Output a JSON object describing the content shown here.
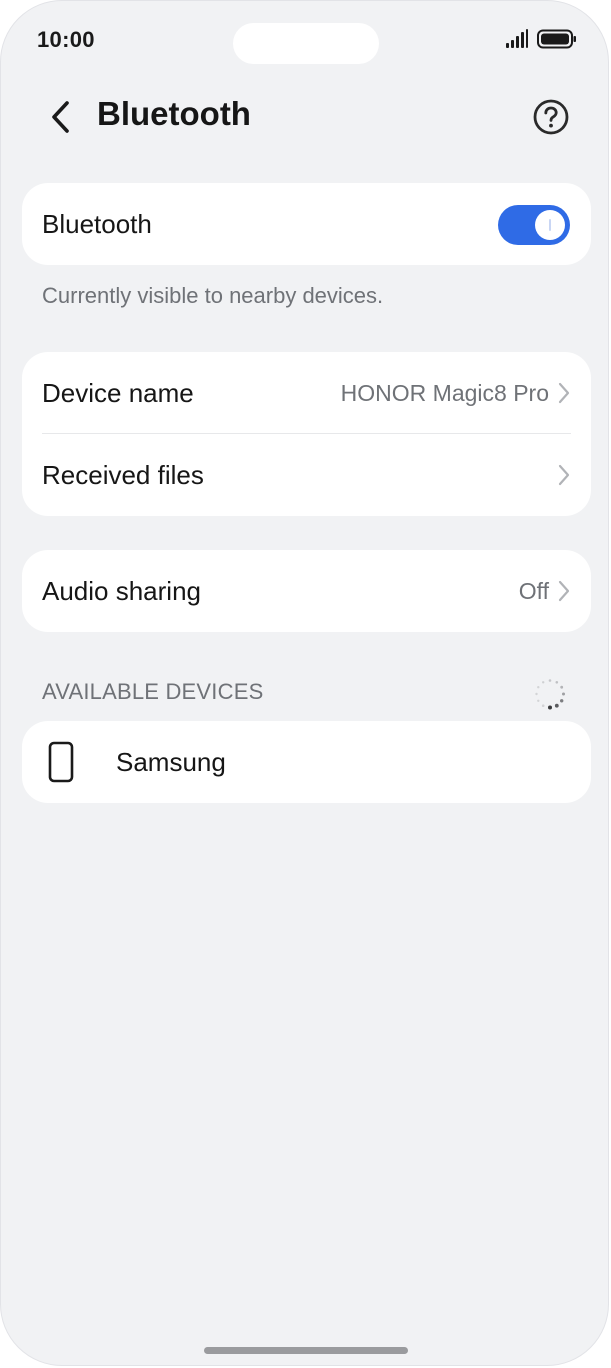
{
  "status_bar": {
    "time": "10:00",
    "signal_icon": "signal-icon",
    "battery_icon": "battery-icon"
  },
  "header": {
    "title": "Bluetooth",
    "back_icon": "back-arrow-icon",
    "help_icon": "help-icon"
  },
  "bluetooth_toggle": {
    "label": "Bluetooth",
    "enabled": true,
    "caption": "Currently visible to nearby devices."
  },
  "device_settings": {
    "items": [
      {
        "label": "Device name",
        "value": "HONOR Magic8 Pro"
      },
      {
        "label": "Received files",
        "value": ""
      }
    ]
  },
  "audio_sharing": {
    "label": "Audio sharing",
    "value": "Off"
  },
  "available_devices": {
    "header": "AVAILABLE DEVICES",
    "spinner_icon": "loading-spinner-icon",
    "devices": [
      {
        "name": "Samsung",
        "icon": "phone-icon"
      }
    ]
  },
  "colors": {
    "accent": "#2f6be6",
    "background": "#f1f2f4",
    "card": "#ffffff",
    "secondary_text": "#6f7277"
  }
}
